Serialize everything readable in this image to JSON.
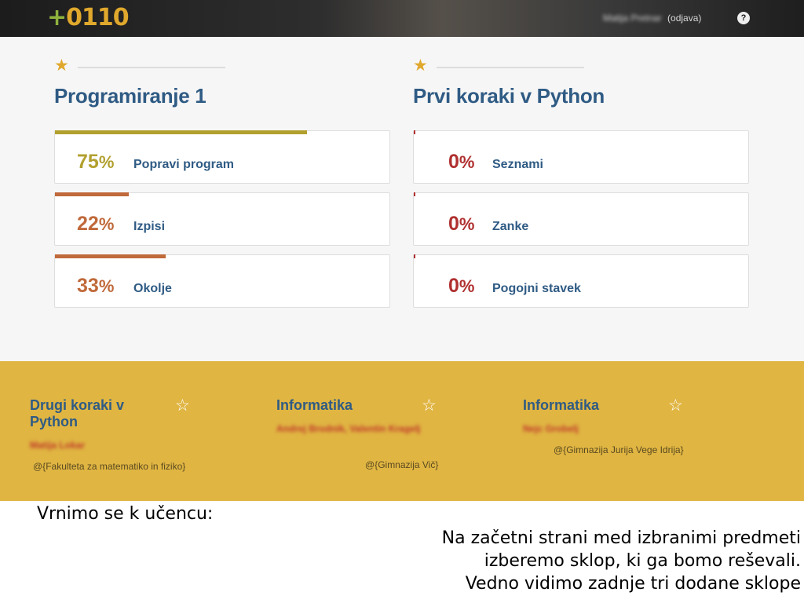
{
  "header": {
    "logo_plus": "+",
    "logo_digits": "0110",
    "user_name": "Matija Pretnar",
    "logout_label": "(odjava)",
    "help_label": "?"
  },
  "courses": [
    {
      "title": "Programiranje 1",
      "items": [
        {
          "percent": "75",
          "sign": "%",
          "label": "Popravi program",
          "progress": 0.75,
          "color": "#b2a02e"
        },
        {
          "percent": "22",
          "sign": "%",
          "label": "Izpisi",
          "progress": 0.22,
          "color": "#c0693a"
        },
        {
          "percent": "33",
          "sign": "%",
          "label": "Okolje",
          "progress": 0.33,
          "color": "#c0693a"
        }
      ]
    },
    {
      "title": "Prvi koraki v Python",
      "items": [
        {
          "percent": "0",
          "sign": "%",
          "label": "Seznami",
          "progress": 0,
          "color": "#b03030"
        },
        {
          "percent": "0",
          "sign": "%",
          "label": "Zanke",
          "progress": 0,
          "color": "#b03030"
        },
        {
          "percent": "0",
          "sign": "%",
          "label": "Pogojni stavek",
          "progress": 0,
          "color": "#b03030"
        }
      ]
    }
  ],
  "other_courses": [
    {
      "title": "Drugi koraki v Python",
      "author": "Matija Lokar",
      "school": "@{Fakulteta za matematiko in fiziko}"
    },
    {
      "title": "Informatika",
      "author": "Andrej Brodnik, Valentin Kragelj",
      "school": "@{Gimnazija Vič}"
    },
    {
      "title": "Informatika",
      "author": "Nejc Grobelj",
      "school": "@{Gimnazija Jurija Vege Idrija}"
    }
  ],
  "captions": {
    "left": "Vrnimo se k učencu:",
    "right_lines": [
      "Na začetni strani med izbranimi predmeti",
      "izberemo sklop, ki ga bomo reševali.",
      "Vedno vidimo zadnje tri dodane sklope"
    ]
  },
  "icons": {
    "favorite": "star-icon",
    "favorite_empty": "star-outline-icon",
    "help": "help-icon"
  }
}
